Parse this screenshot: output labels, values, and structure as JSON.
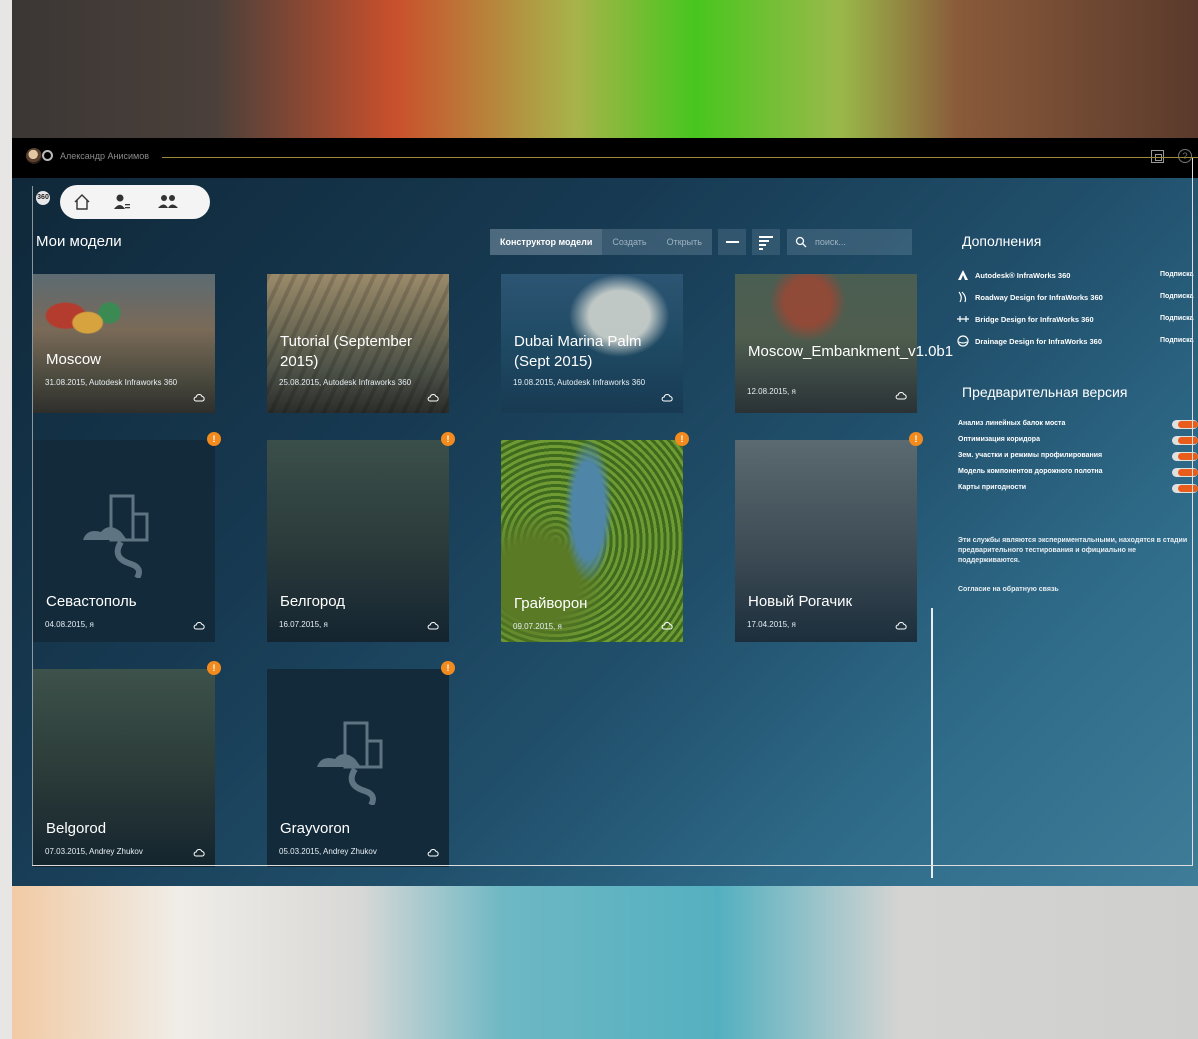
{
  "titlebar": {
    "user_name": "Александр Анисимов",
    "app_badge": "360"
  },
  "my_models": {
    "title": "Мои модели"
  },
  "toolbar": {
    "model_builder": "Конструктор модели",
    "create": "Создать",
    "open": "Открыть",
    "search_placeholder": "поиск..."
  },
  "models": [
    {
      "name": "Moscow",
      "meta": "31.08.2015, Autodesk Infraworks 360",
      "warning": false
    },
    {
      "name": "Tutorial (September 2015)",
      "meta": "25.08.2015, Autodesk Infraworks 360",
      "warning": false
    },
    {
      "name": "Dubai Marina Palm (Sept 2015)",
      "meta": "19.08.2015, Autodesk Infraworks 360",
      "warning": false
    },
    {
      "name": "Moscow_Embankment_v1.0b1",
      "meta": "12.08.2015, я",
      "warning": false
    },
    {
      "name": "Севастополь",
      "meta": "04.08.2015, я",
      "warning": true
    },
    {
      "name": "Белгород",
      "meta": "16.07.2015, я",
      "warning": true
    },
    {
      "name": "Грайворон",
      "meta": "09.07.2015, я",
      "warning": true
    },
    {
      "name": "Новый Рогачик",
      "meta": "17.04.2015, я",
      "warning": true
    },
    {
      "name": "Belgorod",
      "meta": "07.03.2015, Andrey Zhukov",
      "warning": true
    },
    {
      "name": "Grayvoron",
      "meta": "05.03.2015, Andrey Zhukov",
      "warning": true
    }
  ],
  "warning_glyph": "!",
  "addons": {
    "title": "Дополнения",
    "items": [
      {
        "label": "Autodesk® InfraWorks 360",
        "status": "Подписка",
        "icon": "autodesk-logo-icon"
      },
      {
        "label": "Roadway Design for InfraWorks 360",
        "status": "Подписка",
        "icon": "road-icon"
      },
      {
        "label": "Bridge Design for InfraWorks 360",
        "status": "Подписка",
        "icon": "bridge-icon"
      },
      {
        "label": "Drainage Design for InfraWorks 360",
        "status": "Подписка",
        "icon": "drainage-icon"
      }
    ]
  },
  "preview": {
    "title": "Предварительная версия",
    "items": [
      "Анализ линейных балок моста",
      "Оптимизация коридора",
      "Зем. участки и режимы профилирования",
      "Модель компонентов дорожного полотна",
      "Карты пригодности"
    ],
    "note": "Эти службы являются экспериментальными, находятся в стадии предварительного тестирования и официально не поддерживаются.",
    "feedback": "Согласие на обратную связь"
  },
  "colors": {
    "accent": "#f28a1e",
    "toggle": "#e85c1c",
    "panel": "#173a52"
  }
}
